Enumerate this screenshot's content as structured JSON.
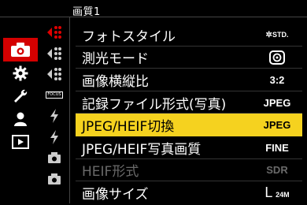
{
  "header": {
    "title": "画質1"
  },
  "menu": {
    "items": [
      {
        "label": "フォトスタイル",
        "value": "STD.",
        "value_icon": "photo-style-std-icon",
        "state": "normal"
      },
      {
        "label": "測光モード",
        "value": "",
        "value_icon": "metering-mode-icon",
        "state": "normal"
      },
      {
        "label": "画像横縦比",
        "value": "3:2",
        "state": "normal"
      },
      {
        "label": "記録ファイル形式(写真)",
        "value": "JPEG",
        "state": "normal"
      },
      {
        "label": "JPEG/HEIF切換",
        "value": "JPEG",
        "state": "selected"
      },
      {
        "label": "JPEG/HEIF写真画質",
        "value": "FINE",
        "state": "normal"
      },
      {
        "label": "HEIF形式",
        "value": "SDR",
        "state": "disabled"
      },
      {
        "label": "画像サイズ",
        "value": "L",
        "value_sub": "24M",
        "state": "normal"
      }
    ]
  },
  "tabs": {
    "focus_badge": "FOCUS"
  },
  "colors": {
    "accent": "#d40000",
    "highlight": "#f5d21f",
    "disabled": "#6a6a6a"
  },
  "nav": {
    "icons": [
      "camera-icon",
      "gear-icon",
      "wrench-icon",
      "person-icon",
      "playback-icon"
    ]
  }
}
